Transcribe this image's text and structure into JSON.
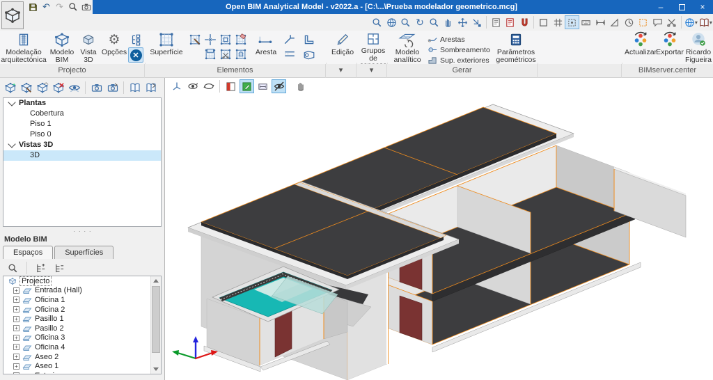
{
  "window": {
    "title": "Open BIM Analytical Model - v2022.a - [C:\\...\\Prueba modelador geometrico.mcg]",
    "controls": [
      "minimize",
      "restore",
      "close"
    ]
  },
  "glyphs": {
    "minus": "–",
    "close": "×",
    "caret": "▾",
    "undo": "↶",
    "redo": "↷",
    "refresh": "↻",
    "gear": "⚙",
    "dots": "· · · ·",
    "plus": "+"
  },
  "quick_access": [
    "save",
    "undo",
    "redo",
    "zoom",
    "capture-view"
  ],
  "nav_toolbar": {
    "icons": [
      "zoom-region",
      "zoom-extents",
      "zoom-previous",
      "redraw",
      "zoom-window",
      "pan",
      "move-view",
      "snap-reference",
      "template-views",
      "import-layers",
      "magnet-snap",
      "frame",
      "grid",
      "object-snap",
      "keyboard-input",
      "dimensions",
      "set-square",
      "protractor",
      "selection-marker",
      "comment",
      "trim",
      "bimserver-web",
      "help-book"
    ],
    "active": "object-snap"
  },
  "ribbon": {
    "projecto": {
      "label": "Projecto",
      "buttons": [
        "Modelação arquitectónica",
        "Modelo BIM",
        "Vista 3D",
        "Opções"
      ]
    },
    "elementos": {
      "label": "Elementos",
      "superficie": "Superfície",
      "aresta": "Aresta"
    },
    "edicao": {
      "button": "Edição"
    },
    "grupos": {
      "button": "Grupos de espaços"
    },
    "gerar": {
      "label": "Gerar",
      "modelo_analitico": "Modelo analítico",
      "arestas": "Arestas",
      "sombreamento": "Sombreamento",
      "sup_exteriores": "Sup. exteriores",
      "parametros": "Parâmetros geométricos"
    },
    "bimserver": {
      "label": "BIMserver.center",
      "actualizar": "Actualizar",
      "exportar": "Exportar",
      "user": "Ricardo Figueira"
    }
  },
  "left_panel": {
    "views_toolbar": [
      "view-add",
      "view-edit",
      "view-copy",
      "view-delete",
      "view-visibility",
      "capture",
      "capture-update",
      "book-open",
      "book-go"
    ],
    "views_tree": {
      "groups": [
        {
          "label": "Plantas",
          "children": [
            "Cobertura",
            "Piso 1",
            "Piso 0"
          ]
        },
        {
          "label": "Vistas 3D",
          "children": [
            "3D"
          ]
        }
      ],
      "selected": "3D"
    },
    "modelo_bim": {
      "title": "Modelo BIM",
      "tabs": [
        "Espaços",
        "Superfícies"
      ],
      "active_tab": "Espaços",
      "tools": [
        "search",
        "expand-all",
        "collapse-all"
      ],
      "spaces_tree": {
        "root": "Projecto",
        "items": [
          "Entrada (Hall)",
          "Oficina 1",
          "Oficina 2",
          "Pasillo 1",
          "Pasillo 2",
          "Oficina 3",
          "Oficina 4",
          "Aseo 2",
          "Aseo 1",
          "Exterior"
        ]
      }
    }
  },
  "viewport": {
    "toolbar": [
      "axes-tripod",
      "orbit",
      "spin",
      "section-planes",
      "edit-surfaces",
      "dimensions",
      "hide-elements",
      "grab"
    ],
    "active_toggles": [
      "edit-surfaces",
      "hide-elements"
    ]
  },
  "colors": {
    "titlebar": "#1766bd",
    "highlight": "#cfe5f7",
    "accent_orange": "#ef8c1e",
    "slab_dark": "#3d3d3f",
    "wall_gray": "#dcdcdc",
    "roof_teal": "#17b8b4",
    "door_red": "#7a3332",
    "selection": "#cbe8fa",
    "icon_blue": "#3d6fa8"
  }
}
